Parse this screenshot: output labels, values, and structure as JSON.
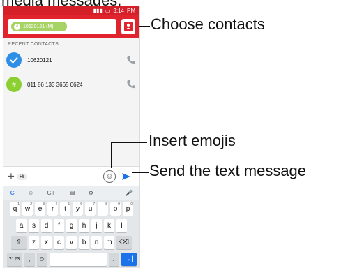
{
  "caption_top": "media messages.",
  "status": {
    "time": "3:14",
    "ampm": "PM"
  },
  "recipient": {
    "chip_label": "10620121 (M)",
    "chip_icon": "#"
  },
  "recent": {
    "header": "RECENT CONTACTS",
    "contacts": [
      {
        "number": "10620121",
        "avatar": "check",
        "color": "#2f8fe6"
      },
      {
        "number": "011 86 133 3665 0624",
        "avatar": "#",
        "color": "#8ccf32"
      }
    ]
  },
  "composer": {
    "hint": "Hi"
  },
  "suggest_bar": [
    "G",
    "☺",
    "GIF",
    "▤",
    "⚙",
    "···",
    "🎤"
  ],
  "keyboard": {
    "row1": [
      {
        "k": "q",
        "n": "1"
      },
      {
        "k": "w",
        "n": "2"
      },
      {
        "k": "e",
        "n": "3"
      },
      {
        "k": "r",
        "n": "4"
      },
      {
        "k": "t",
        "n": "5"
      },
      {
        "k": "y",
        "n": "6"
      },
      {
        "k": "u",
        "n": "7"
      },
      {
        "k": "i",
        "n": "8"
      },
      {
        "k": "o",
        "n": "9"
      },
      {
        "k": "p",
        "n": "0"
      }
    ],
    "row2": [
      "a",
      "s",
      "d",
      "f",
      "g",
      "h",
      "j",
      "k",
      "l"
    ],
    "row3": [
      "z",
      "x",
      "c",
      "v",
      "b",
      "n",
      "m"
    ],
    "symbols_key": "?123",
    "comma_key": ",",
    "period_key": "."
  },
  "callouts": {
    "choose_contacts": "Choose contacts",
    "insert_emojis": "Insert emojis",
    "send": "Send the text message"
  },
  "colors": {
    "accent": "#e0232c",
    "send": "#1a73e8"
  }
}
